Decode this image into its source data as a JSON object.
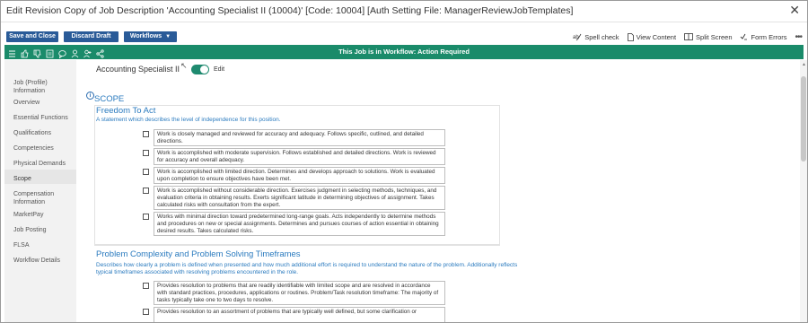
{
  "window": {
    "title": "Edit Revision Copy of Job Description 'Accounting Specialist II (10004)' [Code: 10004] [Auth Setting File: ManagerReviewJobTemplates]",
    "close_symbol": "✕"
  },
  "toolbar": {
    "save_label": "Save and Close",
    "discard_label": "Discard Draft",
    "workflows_label": "Workflows",
    "spell_check": "Spell check",
    "view_content": "View Content",
    "split_screen": "Split Screen",
    "form_errors": "Form Errors",
    "more": "•••"
  },
  "workflow_bar": {
    "message": "This Job is in Workflow: Action Required",
    "icons": [
      "list-icon",
      "thumbs-up-icon",
      "thumbs-down-icon",
      "document-icon",
      "comment-icon",
      "person-icon",
      "add-user-icon",
      "share-icon"
    ]
  },
  "nav": {
    "items": [
      {
        "label": "Job (Profile) Information"
      },
      {
        "label": "Overview"
      },
      {
        "label": "Essential Functions"
      },
      {
        "label": "Qualifications"
      },
      {
        "label": "Competencies"
      },
      {
        "label": "Physical Demands"
      },
      {
        "label": "Scope"
      },
      {
        "label": "Compensation Information"
      },
      {
        "label": "MarketPay"
      },
      {
        "label": "Job Posting"
      },
      {
        "label": "FLSA"
      },
      {
        "label": "Workflow Details"
      }
    ],
    "active": "Scope"
  },
  "main": {
    "job_title": "Accounting Specialist II",
    "edit_label": "Edit",
    "edit_toggle_on": true,
    "scope_heading": "SCOPE",
    "section1": {
      "title": "Freedom To Act",
      "description": "A statement which describes the level of independence for this position.",
      "options": [
        "Work is closely managed and reviewed for accuracy and adequacy.  Follows specific, outlined, and detailed directions.",
        "Work is accomplished with moderate supervision.  Follows established and detailed directions.  Work is reviewed for accuracy and overall adequacy.",
        "Work is accomplished with limited direction.  Determines and develops approach to solutions.  Work is evaluated upon completion to ensure objectives have been met.",
        "Work is accomplished without considerable direction.  Exercises judgment in selecting methods, techniques, and evaluation criteria in obtaining results.  Exerts significant latitude in determining objectives of assignment.  Takes calculated risks with consultation from the expert.",
        "Works with minimal direction toward predetermined long-range goals.  Acts independently to determine methods and procedures on new or special assignments. Determines and pursues courses of action essential in obtaining desired results. Takes calculated risks."
      ]
    },
    "section2": {
      "title": "Problem Complexity and Problem Solving Timeframes",
      "description": "Describes how clearly a problem is defined when presented and how much additional effort is required to understand the nature of the problem. Additionally reflects typical timeframes associated with resolving problems encountered in the role.",
      "options": [
        "Provides resolution to problems that are readily identifiable with limited scope and are resolved in accordance with standard practices, procedures, applications or routines.  Problem/Task resolution timeframe:  The majority of tasks typically take one to two days to resolve.",
        "Provides resolution to an assortment of problems that are typically well defined,  but some clarification or"
      ]
    }
  }
}
